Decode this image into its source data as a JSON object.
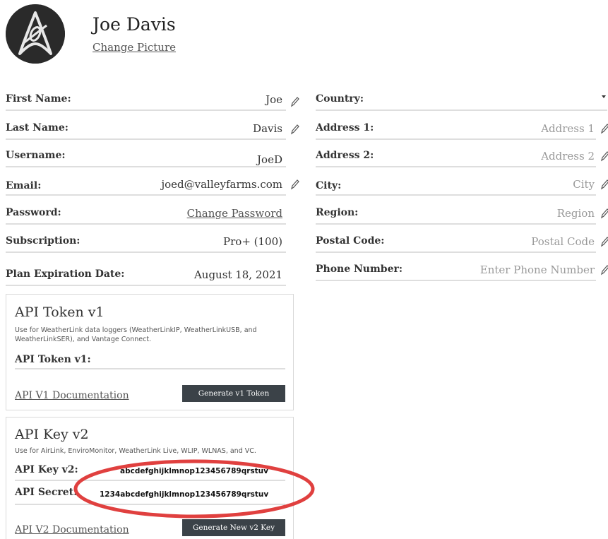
{
  "profile": {
    "name": "Joe Davis",
    "change_picture": "Change Picture",
    "avatar_icon": "starfleet-delta-icon"
  },
  "left_fields": [
    {
      "label": "First Name:",
      "value": "Joe",
      "editable": true
    },
    {
      "label": "Last Name:",
      "value": "Davis",
      "editable": true
    },
    {
      "label": "Username:",
      "value": "JoeD",
      "editable": false
    },
    {
      "label": "Email:",
      "value": "joed@valleyfarms.com",
      "editable": true
    },
    {
      "label": "Password:",
      "value": "Change Password",
      "editable": false,
      "link": true
    },
    {
      "label": "Subscription:",
      "value": "Pro+ (100)",
      "editable": false
    },
    {
      "label": "Plan Expiration Date:",
      "value": "August 18, 2021",
      "editable": false
    }
  ],
  "right_fields": [
    {
      "label": "Country:",
      "value": "",
      "dropdown": true
    },
    {
      "label": "Address 1:",
      "placeholder": "Address 1",
      "editable": true
    },
    {
      "label": "Address 2:",
      "placeholder": "Address 2",
      "editable": true
    },
    {
      "label": "City:",
      "placeholder": "City",
      "editable": true
    },
    {
      "label": "Region:",
      "placeholder": "Region",
      "editable": true
    },
    {
      "label": "Postal Code:",
      "placeholder": "Postal Code",
      "editable": true
    },
    {
      "label": "Phone Number:",
      "placeholder": "Enter Phone Number",
      "editable": true
    }
  ],
  "api_v1": {
    "title": "API Token v1",
    "description": "Use for WeatherLink data loggers (WeatherLinkIP, WeatherLinkUSB, and WeatherLinkSER), and Vantage Connect.",
    "token_label": "API Token v1:",
    "doc_link": "API V1 Documentation",
    "button": "Generate v1 Token"
  },
  "api_v2": {
    "title": "API Key v2",
    "description": "Use for AirLink, EnviroMonitor, WeatherLink Live, WLIP, WLNAS, and VC.",
    "key_label": "API Key v2:",
    "key_value": "abcdefghijklmnop123456789qrstuv",
    "secret_label": "API Secret:",
    "secret_value": "1234abcdefghijklmnop123456789qrstuv",
    "doc_link": "API V2 Documentation",
    "button": "Generate New v2 Key"
  },
  "colors": {
    "highlight_ellipse": "#e0403f",
    "button_bg": "#3b4248",
    "divider": "#dedede"
  }
}
